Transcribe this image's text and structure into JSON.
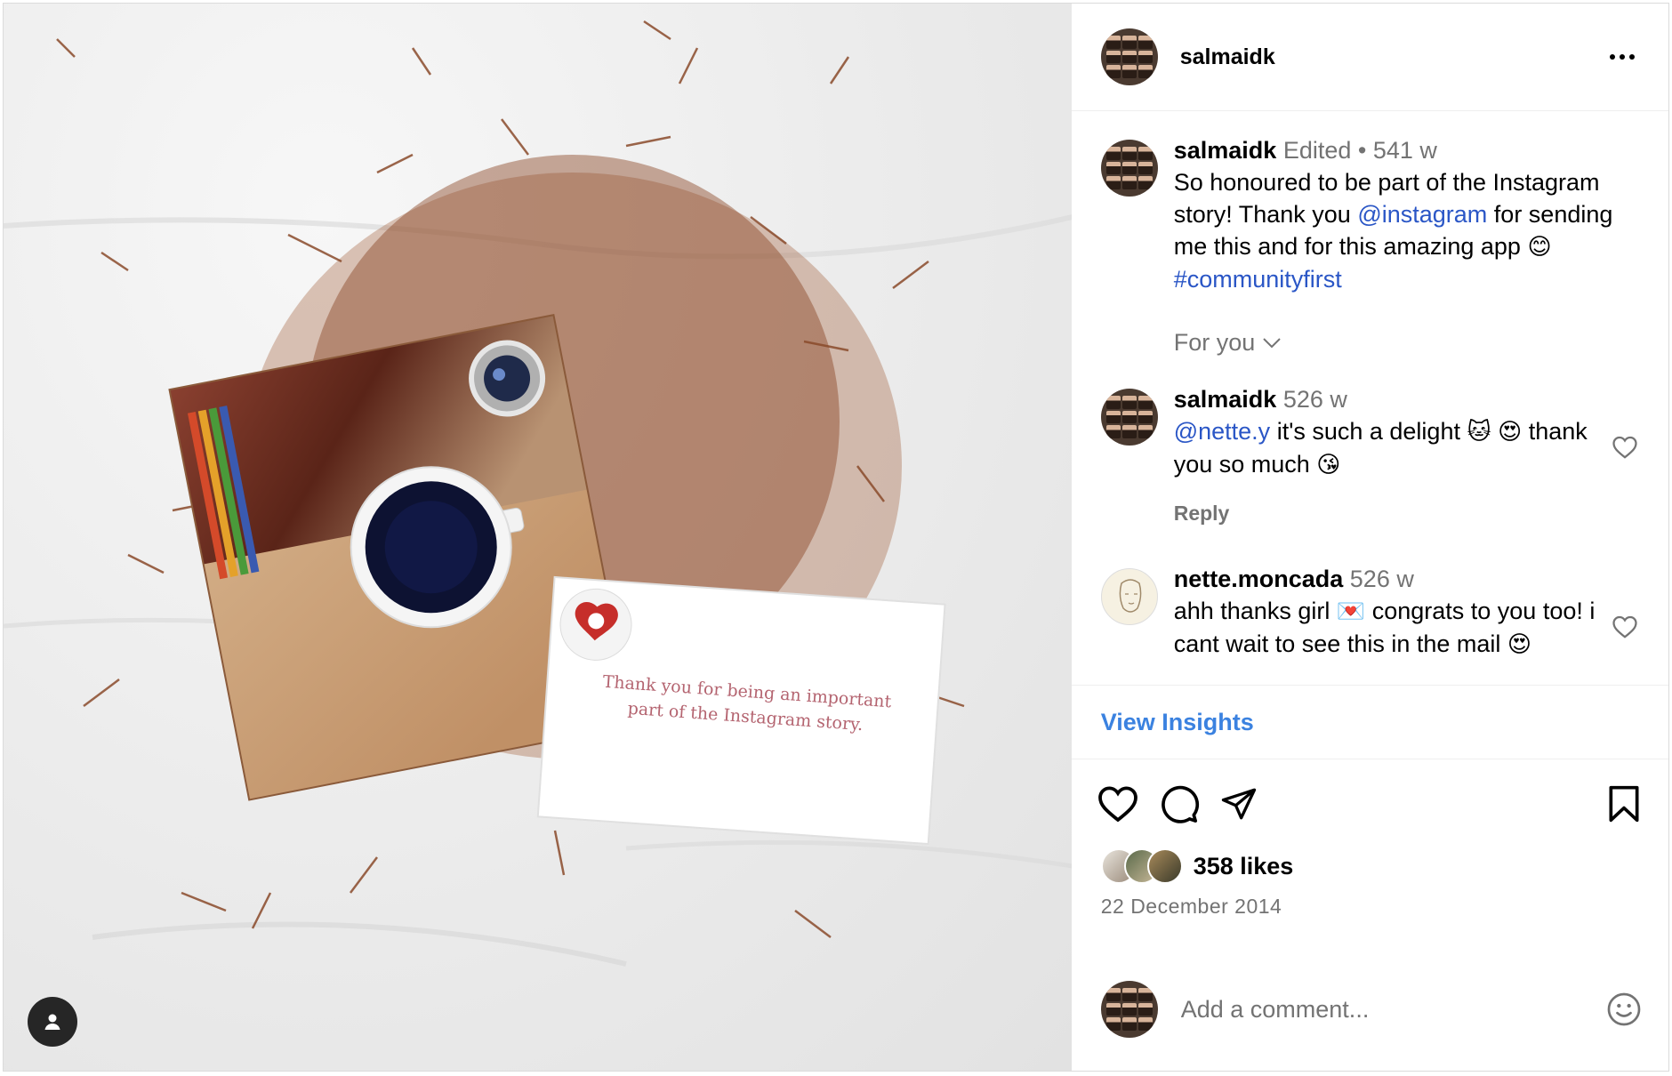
{
  "post": {
    "username": "salmaidk",
    "card_text_line1": "Thank you for being an important",
    "card_text_line2": "part of the Instagram story."
  },
  "caption": {
    "username": "salmaidk",
    "edited": "Edited",
    "separator": "•",
    "time": "541 w",
    "text_part1": "So honoured to be part of the Instagram story! Thank you ",
    "mention": "@instagram",
    "text_part2": " for sending me this and for this amazing app ",
    "emoji": "😊",
    "hashtag": "#communityfirst"
  },
  "filter": {
    "label": "For you"
  },
  "comments": [
    {
      "username": "salmaidk",
      "time": "526 w",
      "mention": "@nette.y",
      "text_part1": " it's such a delight ",
      "emoji1": "🐱",
      "emoji2": "😍",
      "text_part2": " thank you so much ",
      "emoji3": "😘",
      "reply_label": "Reply"
    },
    {
      "username": "nette.moncada",
      "time": "526 w",
      "text_part1": "ahh thanks girl ",
      "emoji1": "💌",
      "text_part2": " congrats to you too! i cant wait to see this in the mail ",
      "emoji2": "😍"
    }
  ],
  "insights": {
    "label": "View Insights"
  },
  "likes": {
    "count": "358 likes"
  },
  "date": {
    "text": "22 December 2014"
  },
  "add_comment": {
    "placeholder": "Add a comment..."
  },
  "colors": {
    "link": "#2a56c6",
    "insights": "#3b82e0",
    "muted": "#737373"
  },
  "icons": [
    "more-icon",
    "heart-icon",
    "comment-icon",
    "share-icon",
    "bookmark-icon",
    "emoji-icon",
    "user-tag-icon"
  ]
}
